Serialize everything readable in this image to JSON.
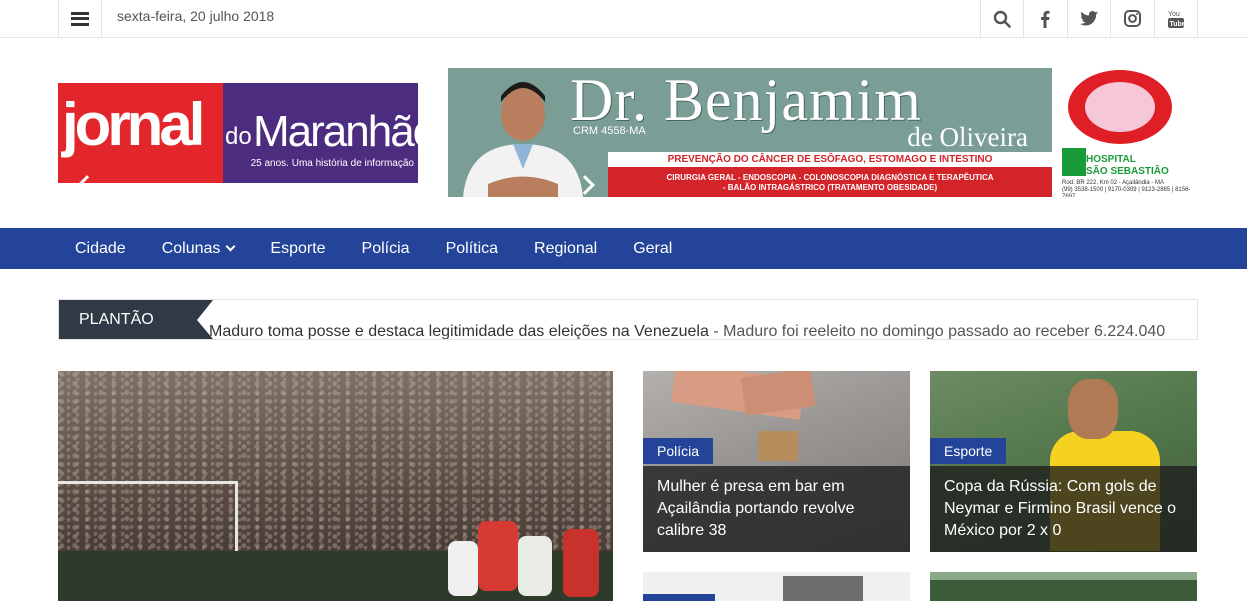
{
  "topbar": {
    "date": "sexta-feira, 20 julho 2018",
    "icons": [
      "search-icon",
      "facebook-icon",
      "twitter-icon",
      "instagram-icon",
      "youtube-icon"
    ]
  },
  "logo": {
    "word1": "jornal",
    "word2": "do",
    "word3": "Maranhão",
    "tagline": "25 anos. Uma história de informação",
    "colors": {
      "red": "#e3262b",
      "purple": "#4b2c7e"
    }
  },
  "ad": {
    "name": "Dr. Benjamim",
    "crm": "CRM 4558-MA",
    "surname": "de Oliveira",
    "line1": "PREVENÇÃO DO CÂNCER DE ESÔFAGO, ESTOMAGO E INTESTINO",
    "line2a": "CIRURGIA GERAL - ENDOSCOPIA - COLONOSCOPIA DIAGNÓSTICA E TERAPÊUTICA",
    "line2b": "- BALÃO INTRAGÁSTRICO (TRATAMENTO OBESIDADE)",
    "hospital1": "HOSPITAL",
    "hospital2": "SÃO SEBASTIÃO",
    "address": "Rod. BR 222, Km 02 - Açailândia - MA",
    "phones": "(99) 3538-1500 | 9170-0309 | 9123-2865 | 8156-7697"
  },
  "nav": {
    "items": [
      "Cidade",
      "Colunas",
      "Esporte",
      "Polícia",
      "Política",
      "Regional",
      "Geral"
    ],
    "color": "#24449a"
  },
  "ticker": {
    "label": "PLANTÃO",
    "headline": "Maduro toma posse e destaca legitimidade das eleições na Venezuela",
    "separator": " - ",
    "excerpt": "Maduro foi reeleito no domingo passado ao receber 6.224.040"
  },
  "cards": [
    {
      "category": "Polícia",
      "title": "Mulher é presa em bar em Açailândia portando revolve calibre 38"
    },
    {
      "category": "Esporte",
      "title": "Copa da Rússia: Com gols de Neymar e Firmino Brasil vence o México por 2 x 0"
    }
  ]
}
